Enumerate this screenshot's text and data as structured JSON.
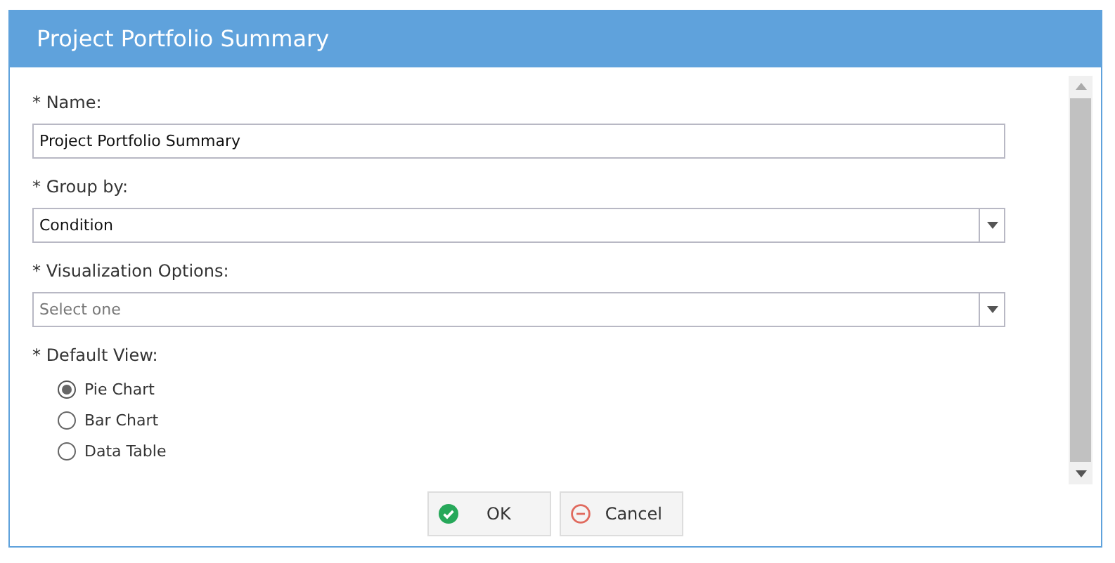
{
  "window": {
    "title": "Project Portfolio Summary"
  },
  "fields": [
    {
      "kind": "text",
      "label": "* Name:",
      "value": "Project Portfolio Summary"
    },
    {
      "kind": "select",
      "label": "* Group by:",
      "value": "Condition"
    },
    {
      "kind": "select",
      "label": "* Visualization Options:",
      "placeholder": "Select one"
    }
  ],
  "default_view": {
    "label": "* Default View:",
    "options": [
      {
        "label": "Pie Chart",
        "selected": true
      },
      {
        "label": "Bar Chart",
        "selected": false
      },
      {
        "label": "Data Table",
        "selected": false
      }
    ]
  },
  "buttons": [
    {
      "kind": "ok",
      "label": "OK"
    },
    {
      "kind": "cancel",
      "label": "Cancel"
    }
  ]
}
